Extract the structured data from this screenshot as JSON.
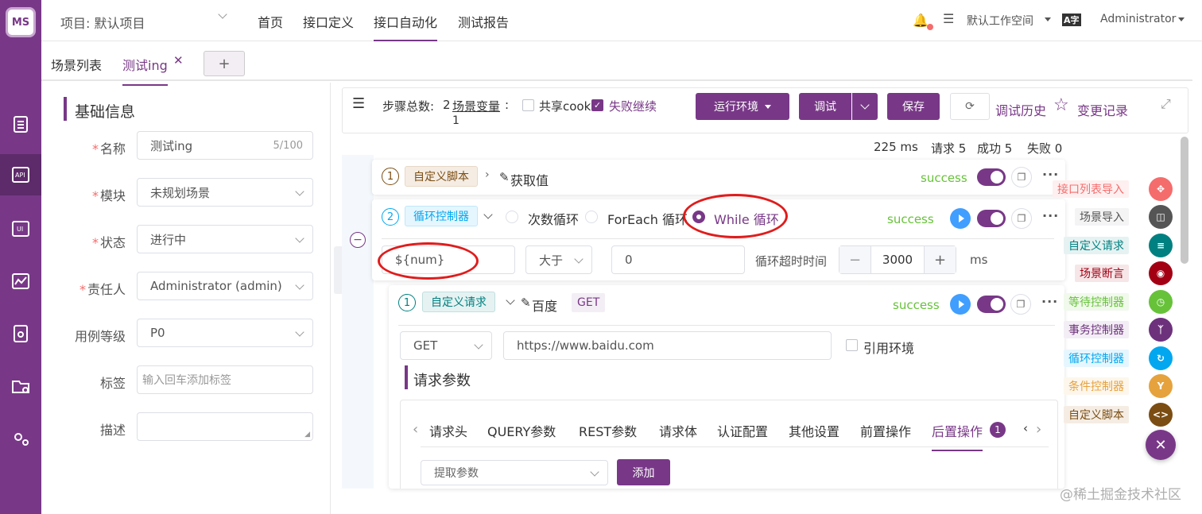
{
  "app": {
    "logo_text": "MS",
    "brand_color": "#783887"
  },
  "topbar": {
    "project": "项目: 默认项目",
    "nav": [
      "首页",
      "接口定义",
      "接口自动化",
      "测试报告"
    ],
    "active_nav": "接口自动化",
    "workspace": "默认工作空间",
    "lang_icon": "A字",
    "user": "Administrator"
  },
  "tabs": {
    "list_label": "场景列表",
    "current": "测试ing",
    "add": "+"
  },
  "basic_info": {
    "title": "基础信息",
    "fields": {
      "name_label": "名称",
      "name_value": "测试ing",
      "name_count": "5/100",
      "module_label": "模块",
      "module_value": "未规划场景",
      "status_label": "状态",
      "status_value": "进行中",
      "owner_label": "责任人",
      "owner_value": "Administrator (admin)",
      "level_label": "用例等级",
      "level_value": "P0",
      "tags_label": "标签",
      "tags_placeholder": "输入回车添加标签",
      "desc_label": "描述"
    }
  },
  "toolbar": {
    "steps_label": "步骤总数:",
    "steps_count": "2",
    "scene_vars": "场景变量",
    "scene_vars_colon": ":",
    "scene_vars_count": "1",
    "share_cookie": "共享cook",
    "fail_continue": "失败继续",
    "env_button": "运行环境",
    "debug_button": "调试",
    "save_button": "保存",
    "history": "调试历史",
    "changelog": "变更记录"
  },
  "summary": {
    "time": "225 ms",
    "requests": "请求 5",
    "success": "成功 5",
    "fail": "失败 0"
  },
  "steps": [
    {
      "index": "1",
      "type": "自定义脚本",
      "name": "获取值",
      "status": "success"
    },
    {
      "index": "2",
      "type": "循环控制器",
      "status": "success",
      "loop_options": [
        "次数循环",
        "ForEach 循环",
        "While 循环"
      ],
      "selected": "While 循环",
      "variable": "${num}",
      "operator": "大于",
      "value": "0",
      "timeout_label": "循环超时时间",
      "timeout_value": "3000",
      "timeout_unit": "ms",
      "minus": "−",
      "plus": "+"
    }
  ],
  "nested_request": {
    "index": "1",
    "type": "自定义请求",
    "name": "百度",
    "method_tag": "GET",
    "status": "success",
    "method": "GET",
    "url": "https://www.baidu.com",
    "use_env": "引用环境",
    "params_title": "请求参数",
    "tabs": [
      "请求头",
      "QUERY参数",
      "REST参数",
      "请求体",
      "认证配置",
      "其他设置",
      "前置操作",
      "后置操作"
    ],
    "active_tab": "后置操作",
    "post_badge": "1",
    "extract_placeholder": "提取参数",
    "add_button": "添加"
  },
  "right_panel": [
    {
      "label": "接口列表导入",
      "color": "#f56c6c"
    },
    {
      "label": "场景导入",
      "color": "#555555"
    },
    {
      "label": "自定义请求",
      "color": "#008080"
    },
    {
      "label": "场景断言",
      "color": "#a30014"
    },
    {
      "label": "等待控制器",
      "color": "#67c23a"
    },
    {
      "label": "事务控制器",
      "color": "#6d317c"
    },
    {
      "label": "循环控制器",
      "color": "#02a7f0"
    },
    {
      "label": "条件控制器",
      "color": "#e6a23c"
    },
    {
      "label": "自定义脚本",
      "color": "#7b4d12"
    }
  ],
  "watermark": "@稀土掘金技术社区"
}
